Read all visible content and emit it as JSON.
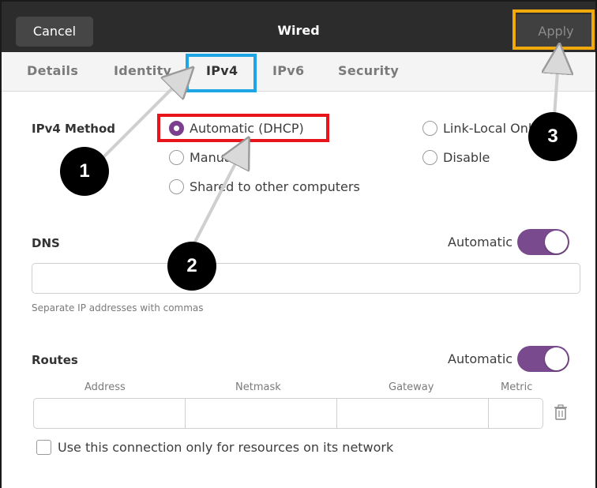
{
  "titlebar": {
    "cancel_label": "Cancel",
    "title": "Wired",
    "apply_label": "Apply"
  },
  "tabs": [
    {
      "label": "Details",
      "active": false
    },
    {
      "label": "Identity",
      "active": false
    },
    {
      "label": "IPv4",
      "active": true
    },
    {
      "label": "IPv6",
      "active": false
    },
    {
      "label": "Security",
      "active": false
    }
  ],
  "ipv4_method": {
    "label": "IPv4 Method",
    "options": [
      {
        "label": "Automatic (DHCP)",
        "checked": true
      },
      {
        "label": "Manual",
        "checked": false
      },
      {
        "label": "Shared to other computers",
        "checked": false
      },
      {
        "label": "Link-Local Only",
        "checked": false
      },
      {
        "label": "Disable",
        "checked": false
      }
    ]
  },
  "dns": {
    "label": "DNS",
    "automatic_label": "Automatic",
    "automatic_on": true,
    "value": "",
    "hint": "Separate IP addresses with commas"
  },
  "routes": {
    "label": "Routes",
    "automatic_label": "Automatic",
    "automatic_on": true,
    "columns": [
      "Address",
      "Netmask",
      "Gateway",
      "Metric"
    ],
    "row": [
      "",
      "",
      "",
      ""
    ]
  },
  "use_only_for_resources": {
    "label": "Use this connection only for resources on its network",
    "checked": false
  },
  "annotations": {
    "colors": {
      "apply_box": "#f2a90b",
      "tab_box": "#1ea5e6",
      "dhcp_box": "#e8141c",
      "accent": "#7b3f8e"
    },
    "steps": [
      "1",
      "2",
      "3"
    ]
  }
}
